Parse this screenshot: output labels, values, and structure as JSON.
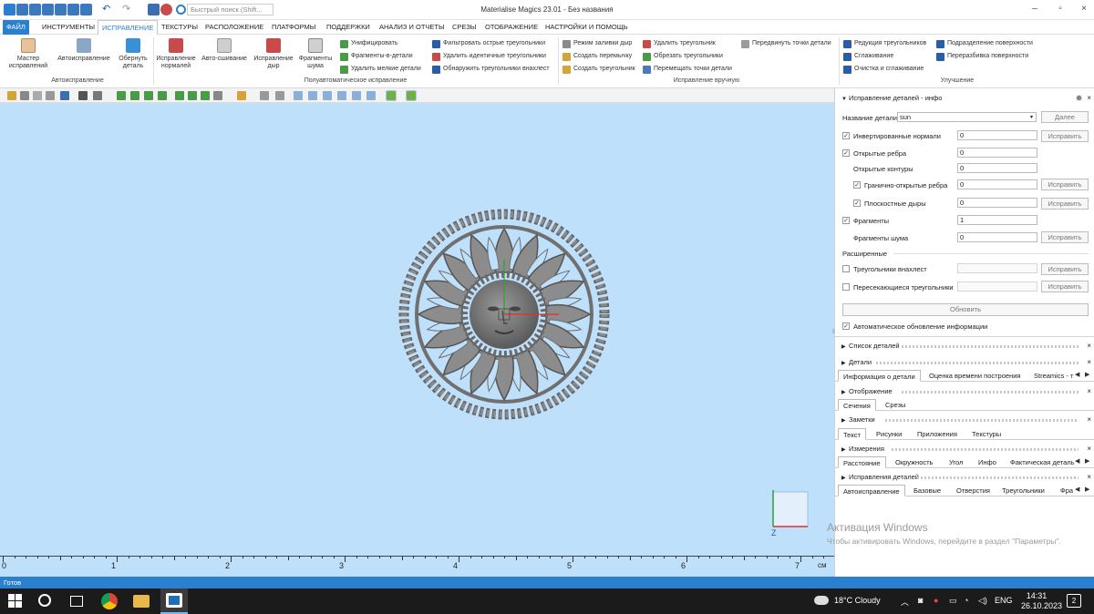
{
  "window": {
    "title": "Materialise Magics 23.01 - Без названия",
    "search_placeholder": "Быстрый поиск (Shift..."
  },
  "menu": [
    "ФАЙЛ",
    "ИНСТРУМЕНТЫ",
    "ИСПРАВЛЕНИЕ",
    "ТЕКСТУРЫ",
    "РАСПОЛОЖЕНИЕ",
    "ПЛАТФОРМЫ",
    "ПОДДЕРЖКИ",
    "АНАЛИЗ И ОТЧЕТЫ",
    "СРЕЗЫ",
    "ОТОБРАЖЕНИЕ",
    "НАСТРОЙКИ И ПОМОЩЬ"
  ],
  "ribbon": {
    "big": [
      "Мастер исправлений",
      "Автоисправление",
      "Обернуть деталь",
      "Исправление нормалей",
      "Авто-сшивание",
      "Исправление дыр",
      "Фрагменты шума"
    ],
    "col1": [
      "Унифицировать",
      "Фрагменты-в-детали",
      "Удалить мелкие детали"
    ],
    "col2": [
      "Фильтровать острые треугольники",
      "Удалить идентичные треугольники",
      "Обнаружить треугольники внахлест"
    ],
    "col3": [
      "Режим заливки дыр",
      "Создать перемычку",
      "Создать треугольник"
    ],
    "col4": [
      "Удалить треугольник",
      "Обрезать треугольники",
      "Перемещать точки детали"
    ],
    "col5": [
      "Передвинуть точки детали"
    ],
    "col6": [
      "Редукция треугольников",
      "Сглаживание",
      "Очистка и сглаживание"
    ],
    "col7": [
      "Подразделение поверхности",
      "Переразбивка поверхности"
    ],
    "groups": [
      "Автоисправление",
      "Полуавтоматическое исправление",
      "Исправление вручную",
      "Улучшение"
    ]
  },
  "ruler": {
    "labels": [
      "0",
      "1",
      "2",
      "3",
      "4",
      "5",
      "6",
      "7"
    ],
    "unit": "см"
  },
  "status": "Готов",
  "panel": {
    "header": "Исправление деталей - инфо",
    "name_label": "Название детали",
    "name_value": "sun",
    "next_button": "Далее",
    "rows": [
      {
        "label": "Инвертированные нормали",
        "value": "0",
        "checked": true,
        "button": "Исправить"
      },
      {
        "label": "Открытые ребра",
        "value": "0",
        "checked": true,
        "button": ""
      },
      {
        "label": "Открытые контуры",
        "value": "0",
        "checked": null,
        "button": ""
      },
      {
        "label": "Гранично-открытые ребра",
        "value": "0",
        "checked": true,
        "button": "Исправить"
      },
      {
        "label": "Плоскостные дыры",
        "value": "0",
        "checked": true,
        "button": "Исправить"
      },
      {
        "label": "Фрагменты",
        "value": "1",
        "checked": true,
        "button": ""
      },
      {
        "label": "Фрагменты шума",
        "value": "0",
        "checked": null,
        "button": "Исправить"
      }
    ],
    "extended_label": "Расширенные",
    "ext_rows": [
      {
        "label": "Треугольники внахлест",
        "value": "",
        "checked": false,
        "button": "Исправить"
      },
      {
        "label": "Пересекающиеся треугольники",
        "value": "",
        "checked": false,
        "button": "Исправить"
      }
    ],
    "update_button": "Обновить",
    "auto_update_label": "Автоматическое обновление информации",
    "sections": [
      {
        "title": "Список деталей",
        "tabs": []
      },
      {
        "title": "Детали",
        "tabs": [
          "Информация о детали",
          "Оценка времени построения",
          "Streamics - т"
        ]
      },
      {
        "title": "Отображение",
        "tabs": [
          "Сечения",
          "Срезы"
        ]
      },
      {
        "title": "Заметки",
        "tabs": [
          "Текст",
          "Рисунки",
          "Приложения",
          "Текстуры"
        ]
      },
      {
        "title": "Измерения",
        "tabs": [
          "Расстояние",
          "Окружность",
          "Угол",
          "Инфо",
          "Фактическая деталь"
        ]
      },
      {
        "title": "Исправления деталей",
        "tabs": [
          "Автоисправление",
          "Базовые",
          "Отверстия",
          "Треугольники",
          "Фра"
        ]
      }
    ]
  },
  "watermark": {
    "title": "Активация Windows",
    "text": "Чтобы активировать Windows, перейдите в раздел \"Параметры\"."
  },
  "taskbar": {
    "weather": "18°C  Cloudy",
    "lang": "ENG",
    "time": "14:31",
    "date": "26.10.2023",
    "notif": "2"
  },
  "colors": {
    "accent": "#2a7fcf",
    "viewport": "#bfe0fb",
    "taskbar": "#1b1b1b"
  }
}
